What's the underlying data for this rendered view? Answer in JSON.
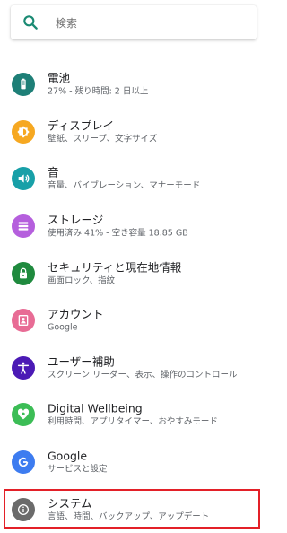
{
  "search": {
    "placeholder": "検索",
    "icon": "search-icon",
    "accent": "#1a8a73"
  },
  "items": [
    {
      "name": "battery",
      "title": "電池",
      "subtitle": "27% - 残り時間: 2 日以上",
      "icon": "battery-icon",
      "color": "#1e7f77"
    },
    {
      "name": "display",
      "title": "ディスプレイ",
      "subtitle": "壁紙、スリープ、文字サイズ",
      "icon": "brightness-icon",
      "color": "#f6a821"
    },
    {
      "name": "sound",
      "title": "音",
      "subtitle": "音量、バイブレーション、マナーモード",
      "icon": "volume-icon",
      "color": "#18a0a8"
    },
    {
      "name": "storage",
      "title": "ストレージ",
      "subtitle": "使用済み 41% - 空き容量 18.85 GB",
      "icon": "storage-icon",
      "color": "#b55fdd"
    },
    {
      "name": "security",
      "title": "セキュリティと現在地情報",
      "subtitle": "画面ロック、指紋",
      "icon": "lock-icon",
      "color": "#1f8a3e"
    },
    {
      "name": "accounts",
      "title": "アカウント",
      "subtitle": "Google",
      "icon": "account-icon",
      "color": "#e86c95"
    },
    {
      "name": "accessibility",
      "title": "ユーザー補助",
      "subtitle": "スクリーン リーダー、表示、操作のコントロール",
      "icon": "accessibility-icon",
      "color": "#4b1ab5"
    },
    {
      "name": "digital-wellbeing",
      "title": "Digital Wellbeing",
      "subtitle": "利用時間、アプリタイマー、おやすみモード",
      "icon": "wellbeing-icon",
      "color": "#3cbd56"
    },
    {
      "name": "google",
      "title": "Google",
      "subtitle": "サービスと設定",
      "icon": "google-icon",
      "color": "#3d7cf0"
    },
    {
      "name": "system",
      "title": "システム",
      "subtitle": "言語、時間、バックアップ、アップデート",
      "icon": "info-icon",
      "color": "#6b6b6b"
    }
  ],
  "highlight_color": "#e32028"
}
